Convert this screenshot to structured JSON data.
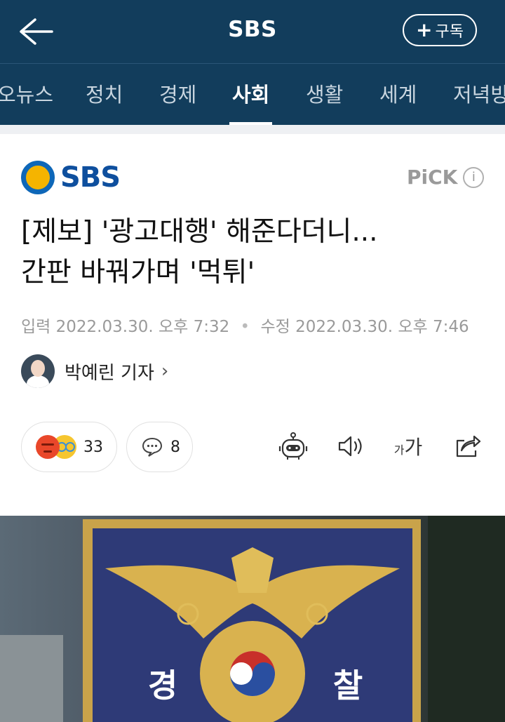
{
  "header": {
    "title": "SBS",
    "subscribe_label": "구독"
  },
  "tabs": [
    {
      "label": "오뉴스",
      "active": false
    },
    {
      "label": "정치",
      "active": false
    },
    {
      "label": "경제",
      "active": false
    },
    {
      "label": "사회",
      "active": true
    },
    {
      "label": "생활",
      "active": false
    },
    {
      "label": "세계",
      "active": false
    },
    {
      "label": "저녁방",
      "active": false
    }
  ],
  "article": {
    "press_name": "SBS",
    "pick_label": "PiCK",
    "pick_info": "i",
    "headline_line1": "[제보] '광고대행' 해준다더니...",
    "headline_line2": "간판 바꿔가며 '먹튀'",
    "input_label": "입력",
    "input_time": "2022.03.30. 오후 7:32",
    "edit_label": "수정",
    "edit_time": "2022.03.30. 오후 7:46",
    "reporter": "박예린 기자"
  },
  "actions": {
    "reaction_count": "33",
    "comment_count": "8",
    "font_small": "가",
    "font_large": "가"
  },
  "photo": {
    "left_char": "경",
    "right_char": "찰"
  },
  "colors": {
    "header_bg": "#123d5c",
    "press_blue": "#0e4f9e",
    "press_yellow": "#f5b400"
  }
}
